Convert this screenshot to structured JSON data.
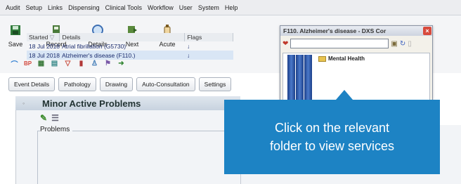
{
  "menu": [
    "Audit",
    "Setup",
    "Links",
    "Dispensing",
    "Clinical Tools",
    "Workflow",
    "User",
    "System",
    "Help"
  ],
  "toolbar": {
    "buttons": [
      {
        "label": "Save",
        "icon": "save-icon"
      },
      {
        "label": "Record",
        "icon": "record-icon"
      },
      {
        "label": "Details",
        "icon": "details-icon"
      },
      {
        "label": "Next",
        "icon": "next-icon"
      },
      {
        "label": "Acute",
        "icon": "acute-icon"
      }
    ]
  },
  "tabs": [
    "Event Details",
    "Pathology",
    "Drawing",
    "Auto-Consultation",
    "Settings"
  ],
  "panel": {
    "title": "Minor Active Problems",
    "problems_label": "Problems",
    "columns": [
      "Started",
      "Details",
      "Flags"
    ],
    "rows": [
      {
        "started": "18 Jul 2018",
        "details": "Atrial fibrillation (G5730)",
        "flag": "↓"
      },
      {
        "started": "18 Jul 2018",
        "details": "Alzheimer's disease (F110.)",
        "flag": "↓"
      }
    ]
  },
  "popup": {
    "title": "F110. Alzheimer's disease - DXS Cor",
    "folder": "Mental Health"
  },
  "tooltip": {
    "line1": "Click on the relevant",
    "line2": "folder to view services"
  },
  "colors": {
    "tooltip_bg": "#1d83c4",
    "header_bg": "#c8d3df",
    "selected_row": "#d9e6f5"
  }
}
